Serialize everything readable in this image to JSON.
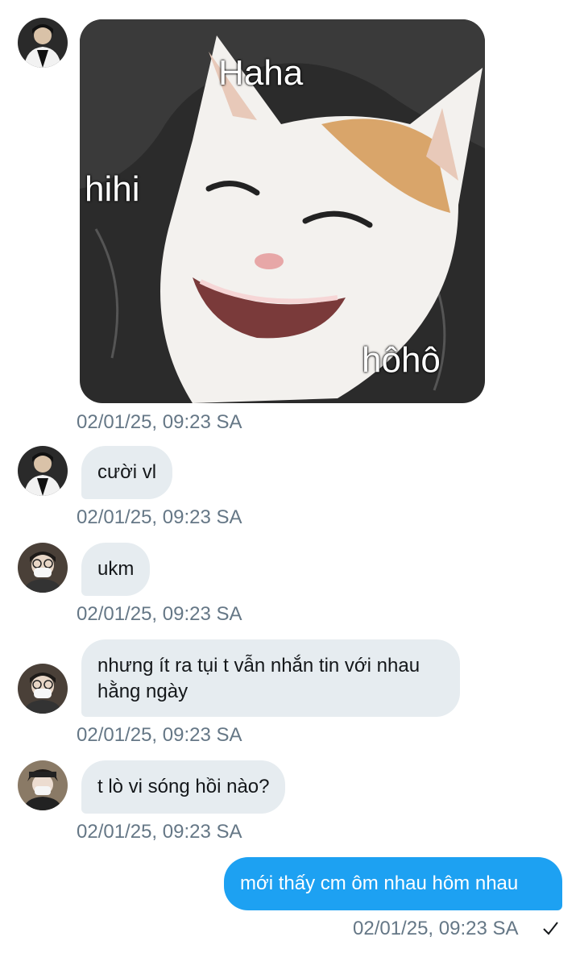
{
  "conversation": {
    "messages": [
      {
        "id": "m1",
        "direction": "incoming",
        "type": "image",
        "meme_text": {
          "top": "Haha",
          "left": "hihi",
          "bottom_right": "hôhô"
        },
        "timestamp": "02/01/25, 09:23 SA"
      },
      {
        "id": "m2",
        "direction": "incoming",
        "text": "cười vl",
        "timestamp": "02/01/25, 09:23 SA"
      },
      {
        "id": "m3",
        "direction": "incoming",
        "text": "ukm",
        "timestamp": "02/01/25, 09:23 SA"
      },
      {
        "id": "m4",
        "direction": "incoming",
        "text": "nhưng ít ra tụi t vẫn nhắn tin với nhau hằng ngày",
        "timestamp": "02/01/25, 09:23 SA"
      },
      {
        "id": "m5",
        "direction": "incoming",
        "text": "t lò vi sóng hồi nào?",
        "timestamp": "02/01/25, 09:23 SA"
      },
      {
        "id": "m6",
        "direction": "outgoing",
        "text": "mới thấy cm ôm nhau hôm nhau",
        "timestamp": "02/01/25, 09:23 SA",
        "status_icon": "check-icon"
      }
    ]
  },
  "colors": {
    "incoming_bubble": "#e6ecf0",
    "outgoing_bubble": "#1da1f2",
    "timestamp": "#657786"
  }
}
